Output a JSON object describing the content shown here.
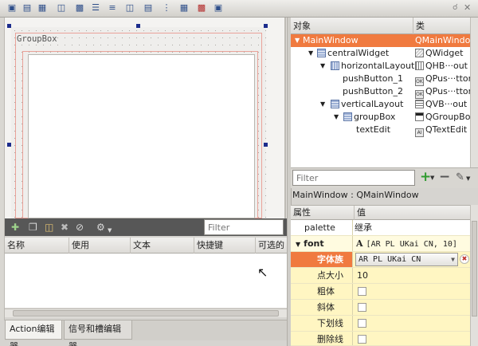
{
  "toolbar": {
    "icons": [
      "edit-widgets-icon",
      "edit-signals-slots-icon",
      "edit-buddies-icon",
      "edit-tab-order-icon",
      "layout-horizontal-icon",
      "layout-vertical-icon",
      "layout-splitter-horizontal-icon",
      "layout-splitter-vertical-icon",
      "layout-grid-icon",
      "layout-form-icon",
      "break-layout-icon",
      "adjust-size-icon"
    ],
    "right_icons": [
      "lock-icon",
      "close-icon"
    ]
  },
  "form": {
    "groupbox_title": "GroupBox"
  },
  "action_editor": {
    "filter_placeholder": "Filter",
    "columns": [
      "名称",
      "使用",
      "文本",
      "快捷键",
      "可选的"
    ],
    "tabs": [
      "Action编辑器",
      "信号和槽编辑器"
    ]
  },
  "object_inspector": {
    "columns": [
      "对象",
      "类"
    ],
    "rows": [
      {
        "object": "MainWindow",
        "class": "QMainWindow",
        "level": 0,
        "selected": true
      },
      {
        "object": "centralWidget",
        "class": "QWidget",
        "level": 1
      },
      {
        "object": "horizontalLayout",
        "class": "QHB···out",
        "level": 2
      },
      {
        "object": "pushButton_1",
        "class": "QPus···tton",
        "level": 3
      },
      {
        "object": "pushButton_2",
        "class": "QPus···tton",
        "level": 3
      },
      {
        "object": "verticalLayout",
        "class": "QVB···out",
        "level": 2
      },
      {
        "object": "groupBox",
        "class": "QGroupBox",
        "level": 3
      },
      {
        "object": "textEdit",
        "class": "QTextEdit",
        "level": 4
      }
    ]
  },
  "property_editor": {
    "filter_placeholder": "Filter",
    "context": "MainWindow : QMainWindow",
    "columns": [
      "属性",
      "值"
    ],
    "rows": [
      {
        "name": "palette",
        "value": "继承"
      },
      {
        "name": "font",
        "value": "[AR PL UKai CN, 10]"
      },
      {
        "name": "字体族",
        "value": "AR PL UKai CN"
      },
      {
        "name": "点大小",
        "value": "10"
      },
      {
        "name": "粗体",
        "value": ""
      },
      {
        "name": "斜体",
        "value": ""
      },
      {
        "name": "下划线",
        "value": ""
      },
      {
        "name": "删除线",
        "value": ""
      }
    ],
    "font_glyph": "A"
  },
  "colors": {
    "selection": "#f07a3f",
    "property_bg": "#fffbe0",
    "action_toolbar": "#575757"
  }
}
